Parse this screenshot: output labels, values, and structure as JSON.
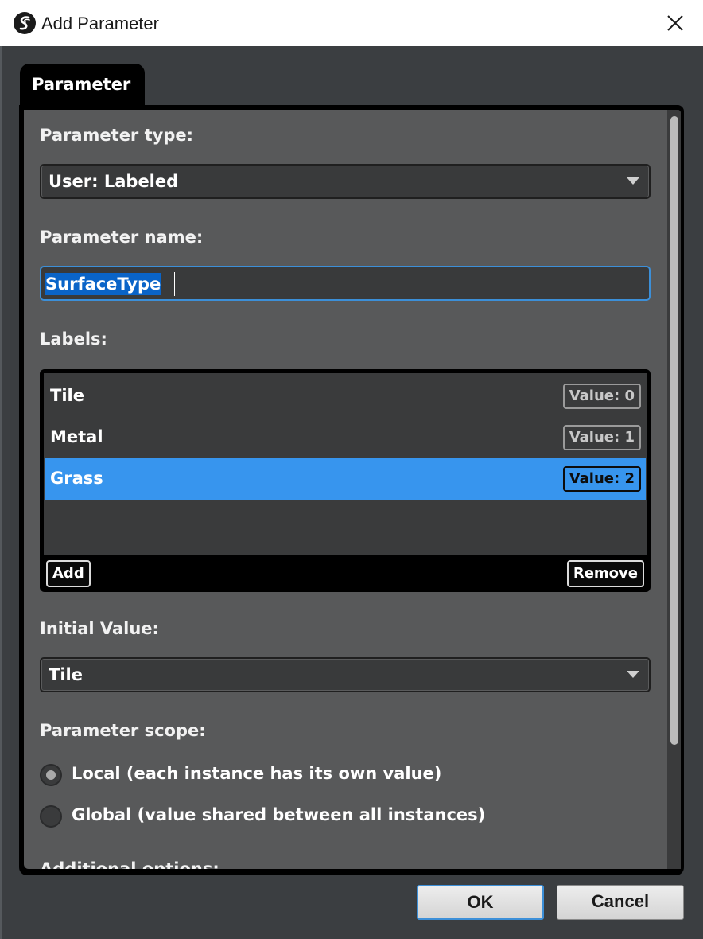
{
  "window": {
    "title": "Add Parameter"
  },
  "tab": {
    "label": "Parameter"
  },
  "form": {
    "parameter_type_label": "Parameter type:",
    "parameter_type_value": "User: Labeled",
    "parameter_name_label": "Parameter name:",
    "parameter_name_value": "SurfaceType",
    "labels_label": "Labels:",
    "labels": [
      {
        "name": "Tile",
        "value": "Value: 0",
        "selected": false
      },
      {
        "name": "Metal",
        "value": "Value: 1",
        "selected": false
      },
      {
        "name": "Grass",
        "value": "Value: 2",
        "selected": true
      }
    ],
    "add_label": "Add",
    "remove_label": "Remove",
    "initial_value_label": "Initial Value:",
    "initial_value": "Tile",
    "scope_label": "Parameter scope:",
    "scope_options": [
      {
        "label": "Local (each instance has its own value)",
        "checked": true
      },
      {
        "label": "Global (value shared between all instances)",
        "checked": false
      }
    ],
    "additional_options_label": "Additional options:"
  },
  "buttons": {
    "ok": "OK",
    "cancel": "Cancel"
  },
  "colors": {
    "selection": "#3795ee",
    "focus": "#3c8fd8",
    "panel": "#58595a"
  }
}
